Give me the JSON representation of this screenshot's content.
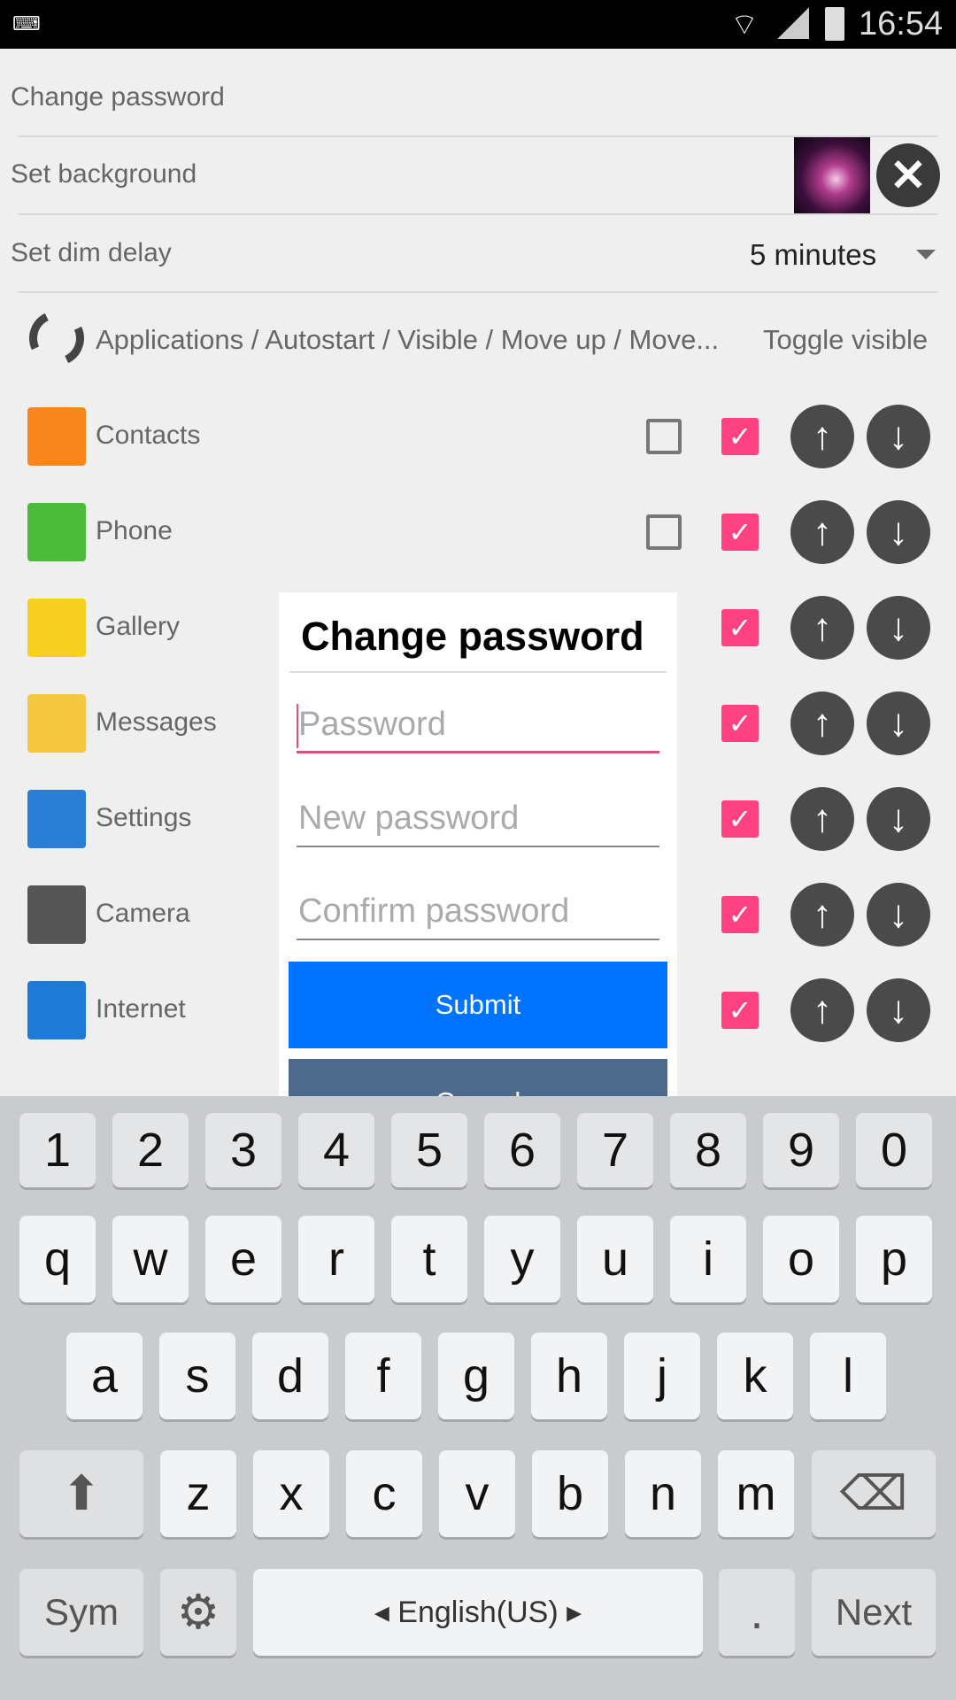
{
  "status_bar": {
    "time": "16:54"
  },
  "settings": {
    "change_password": "Change password",
    "set_background": "Set background",
    "set_dim_delay": "Set dim delay",
    "dim_delay_value": "5 minutes"
  },
  "header": {
    "columns": "Applications / Autostart / Visible / Move up / Move...",
    "toggle": "Toggle visible"
  },
  "apps": [
    {
      "label": "Contacts",
      "autostart": false,
      "visible": true,
      "color": "#f7861c"
    },
    {
      "label": "Phone",
      "autostart": false,
      "visible": true,
      "color": "#4cbb3c"
    },
    {
      "label": "Gallery",
      "autostart": null,
      "visible": true,
      "color": "#f5d020"
    },
    {
      "label": "Messages",
      "autostart": null,
      "visible": true,
      "color": "#f5c842"
    },
    {
      "label": "Settings",
      "autostart": null,
      "visible": true,
      "color": "#2a7fd4"
    },
    {
      "label": "Camera",
      "autostart": null,
      "visible": true,
      "color": "#555"
    },
    {
      "label": "Internet",
      "autostart": null,
      "visible": true,
      "color": "#1d7bd6"
    }
  ],
  "dialog": {
    "title": "Change password",
    "password_placeholder": "Password",
    "new_password_placeholder": "New password",
    "confirm_password_placeholder": "Confirm password",
    "submit": "Submit",
    "cancel": "Cancel"
  },
  "keyboard": {
    "numbers": [
      "1",
      "2",
      "3",
      "4",
      "5",
      "6",
      "7",
      "8",
      "9",
      "0"
    ],
    "row1": [
      "q",
      "w",
      "e",
      "r",
      "t",
      "y",
      "u",
      "i",
      "o",
      "p"
    ],
    "row2": [
      "a",
      "s",
      "d",
      "f",
      "g",
      "h",
      "j",
      "k",
      "l"
    ],
    "row3": [
      "z",
      "x",
      "c",
      "v",
      "b",
      "n",
      "m"
    ],
    "sym": "Sym",
    "language": "English(US)",
    "next": "Next",
    "period": "."
  },
  "colors": {
    "accent": "#ff4081",
    "submit": "#0073ff",
    "cancel": "#4d6a8c"
  }
}
